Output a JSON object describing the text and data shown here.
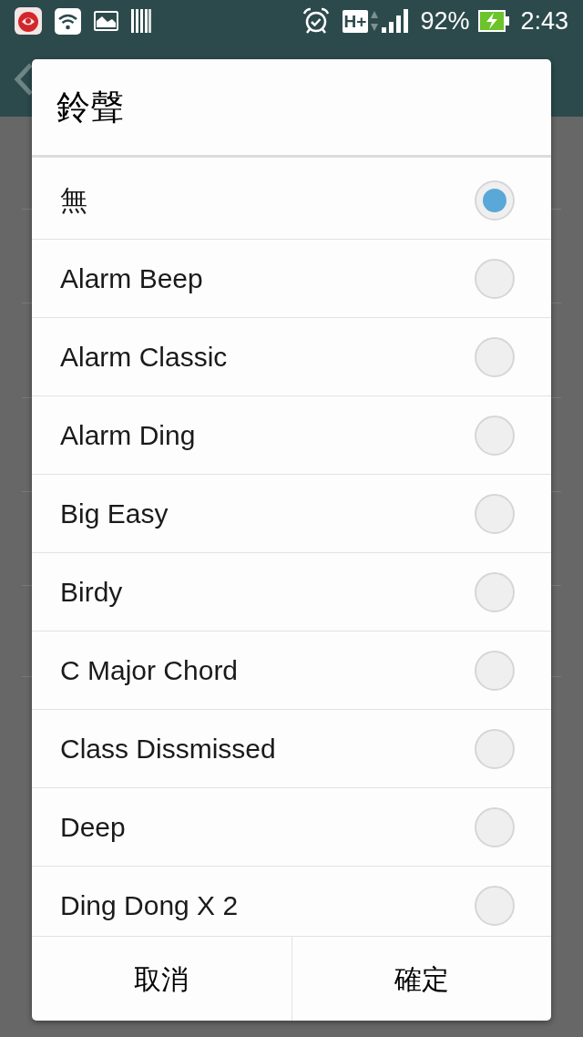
{
  "status_bar": {
    "network_type": "H+",
    "battery": "92%",
    "time": "2:43"
  },
  "dialog": {
    "title": "鈴聲",
    "options": [
      {
        "label": "無",
        "selected": true
      },
      {
        "label": "Alarm Beep",
        "selected": false
      },
      {
        "label": "Alarm Classic",
        "selected": false
      },
      {
        "label": "Alarm Ding",
        "selected": false
      },
      {
        "label": "Big Easy",
        "selected": false
      },
      {
        "label": "Birdy",
        "selected": false
      },
      {
        "label": "C Major Chord",
        "selected": false
      },
      {
        "label": "Class Dissmissed",
        "selected": false
      },
      {
        "label": "Deep",
        "selected": false
      },
      {
        "label": "Ding Dong X 2",
        "selected": false
      }
    ],
    "buttons": [
      "取消",
      "確定"
    ]
  }
}
